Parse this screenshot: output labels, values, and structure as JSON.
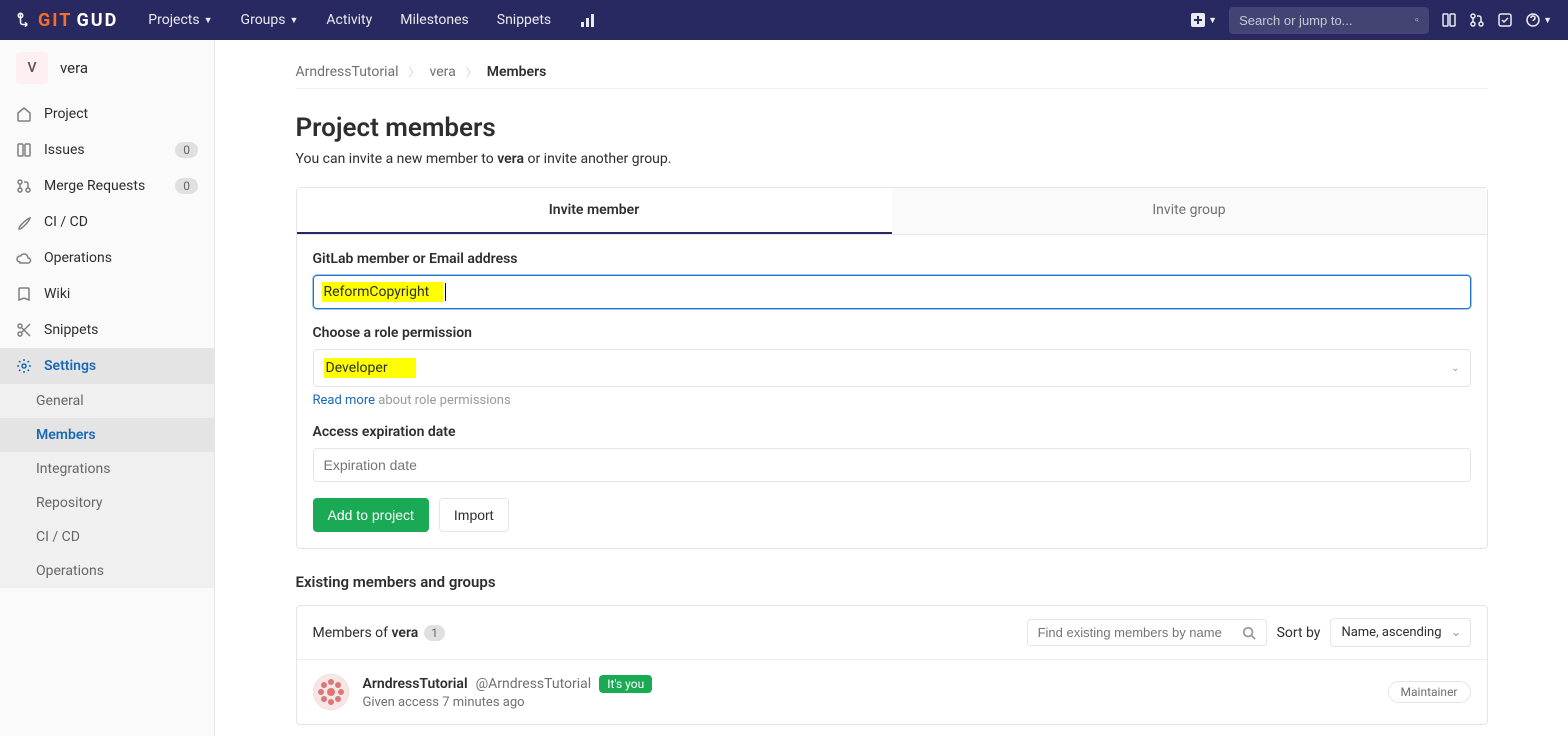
{
  "logo": {
    "git": "GIT",
    "gud": "GUD"
  },
  "topnav": {
    "projects": "Projects",
    "groups": "Groups",
    "activity": "Activity",
    "milestones": "Milestones",
    "snippets": "Snippets"
  },
  "search": {
    "placeholder": "Search or jump to..."
  },
  "sidebar": {
    "project": {
      "initial": "V",
      "name": "vera"
    },
    "items": {
      "project": "Project",
      "issues": "Issues",
      "issues_count": "0",
      "mr": "Merge Requests",
      "mr_count": "0",
      "cicd": "CI / CD",
      "operations": "Operations",
      "wiki": "Wiki",
      "snippets": "Snippets",
      "settings": "Settings"
    },
    "settings_sub": {
      "general": "General",
      "members": "Members",
      "integrations": "Integrations",
      "repository": "Repository",
      "cicd": "CI / CD",
      "operations": "Operations"
    }
  },
  "breadcrumb": {
    "a": "ArndressTutorial",
    "b": "vera",
    "c": "Members"
  },
  "page": {
    "title": "Project members",
    "sub_pre": "You can invite a new member to ",
    "sub_bold": "vera",
    "sub_post": " or invite another group."
  },
  "tabs": {
    "member": "Invite member",
    "group": "Invite group"
  },
  "form": {
    "member_label": "GitLab member or Email address",
    "member_value": "ReformCopyright",
    "role_label": "Choose a role permission",
    "role_value": "Developer",
    "readmore": "Read more",
    "readmore_rest": " about role permissions",
    "expiry_label": "Access expiration date",
    "expiry_placeholder": "Expiration date",
    "add_btn": "Add to project",
    "import_btn": "Import"
  },
  "existing": {
    "title": "Existing members and groups",
    "members_of_pre": "Members of ",
    "members_of_bold": "vera",
    "count": "1",
    "find_placeholder": "Find existing members by name",
    "sort_label": "Sort by",
    "sort_value": "Name, ascending",
    "row": {
      "name": "ArndressTutorial",
      "handle": "@ArndressTutorial",
      "you": "It's you",
      "access": "Given access 7 minutes ago",
      "role": "Maintainer"
    }
  }
}
